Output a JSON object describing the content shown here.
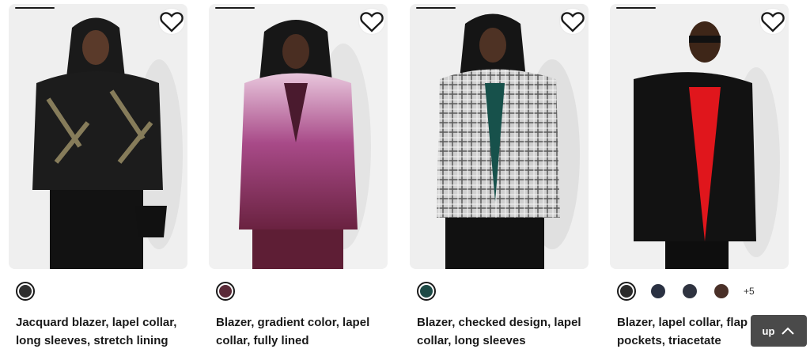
{
  "products": [
    {
      "name": "Jacquard blazer, lapel collar, long sleeves, stretch lining",
      "swatches": [
        {
          "color": "#2f2f2f",
          "selected": true
        }
      ],
      "more": ""
    },
    {
      "name": "Blazer, gradient color, lapel collar, fully lined",
      "swatches": [
        {
          "color": "#5a2a38",
          "selected": true
        }
      ],
      "more": ""
    },
    {
      "name": "Blazer, checked design, lapel collar, long sleeves",
      "swatches": [
        {
          "color": "#1d4a46",
          "selected": true
        }
      ],
      "more": ""
    },
    {
      "name": "Blazer, lapel collar, flap pockets, triacetate",
      "swatches": [
        {
          "color": "#2b2b2b",
          "selected": true
        },
        {
          "color": "#2a3142",
          "selected": false
        },
        {
          "color": "#2f3340",
          "selected": false
        },
        {
          "color": "#4a3028",
          "selected": false
        }
      ],
      "more": "+5"
    }
  ],
  "favorite_icon": "heart-outline-icon",
  "scroll_up": {
    "label": "up",
    "icon": "chevron-up-icon"
  }
}
